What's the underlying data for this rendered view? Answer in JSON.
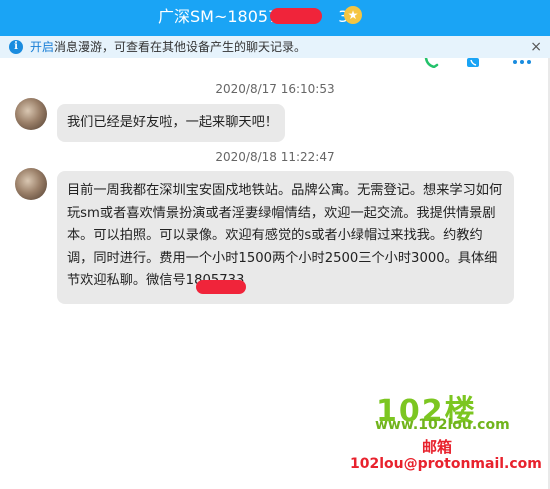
{
  "window": {
    "title_prefix": "广深SM~18057",
    "title_suffix": "3",
    "star_glyph": "★"
  },
  "notice": {
    "link_text": "开启",
    "text": "消息漫游，可查看在其他设备产生的聊天记录。",
    "close_glyph": "×"
  },
  "messages": [
    {
      "timestamp": "2020/8/17 16:10:53",
      "text": "我们已经是好友啦，一起来聊天吧！"
    },
    {
      "timestamp": "2020/8/18 11:22:47",
      "text": "目前一周我都在深圳宝安固戍地铁站。品牌公寓。无需登记。想来学习如何玩sm或者喜欢情景扮演或者淫妻绿帽情结，欢迎一起交流。我提供情景剧本。可以拍照。可以录像。欢迎有感觉的s或者小绿帽过来找我。约教约调，同时进行。费用一个小时1500两个小时2500三个小时3000。具体细节欢迎私聊。微信号1805733"
    }
  ],
  "watermark": {
    "brand": "102楼",
    "site": "www.102lou.com",
    "label": "邮箱",
    "email": "102lou@protonmail.com"
  },
  "colors": {
    "titlebar": "#1aa4f5",
    "notice_bg": "#e6f3fc",
    "bubble": "#e9e9e9",
    "redaction": "#f0243a",
    "brand_green": "#7cc621",
    "brand_red": "#e8222d"
  }
}
